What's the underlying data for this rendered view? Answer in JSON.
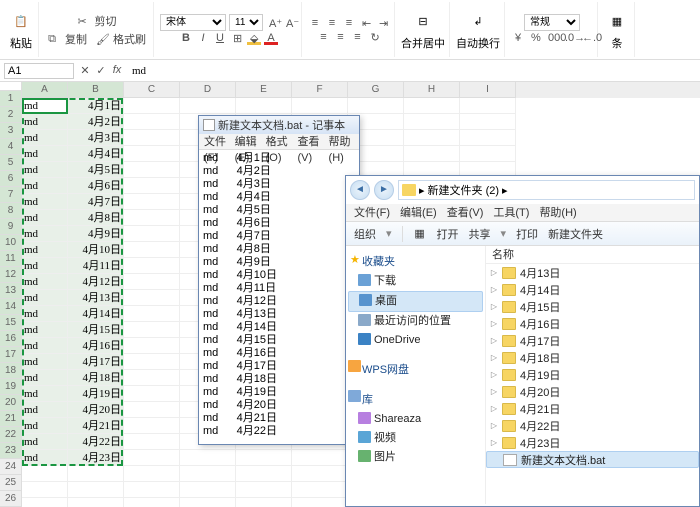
{
  "ribbon": {
    "paste": "粘贴",
    "cut": "剪切",
    "copy": "复制",
    "format_painter": "格式刷",
    "font_name": "宋体",
    "font_size": "11",
    "merge_center": "合并居中",
    "wrap": "自动换行",
    "number_format": "常规",
    "cond": "条"
  },
  "formula_bar": {
    "cell_ref": "A1",
    "formula": "md"
  },
  "columns": [
    "A",
    "B",
    "C",
    "D",
    "E",
    "F",
    "G",
    "H",
    "I"
  ],
  "spreadsheet": {
    "rows": [
      {
        "r": 1,
        "a": "md",
        "b": "4月1日"
      },
      {
        "r": 2,
        "a": "md",
        "b": "4月2日"
      },
      {
        "r": 3,
        "a": "md",
        "b": "4月3日"
      },
      {
        "r": 4,
        "a": "md",
        "b": "4月4日"
      },
      {
        "r": 5,
        "a": "md",
        "b": "4月5日"
      },
      {
        "r": 6,
        "a": "md",
        "b": "4月6日"
      },
      {
        "r": 7,
        "a": "md",
        "b": "4月7日"
      },
      {
        "r": 8,
        "a": "md",
        "b": "4月8日"
      },
      {
        "r": 9,
        "a": "md",
        "b": "4月9日"
      },
      {
        "r": 10,
        "a": "md",
        "b": "4月10日"
      },
      {
        "r": 11,
        "a": "md",
        "b": "4月11日"
      },
      {
        "r": 12,
        "a": "md",
        "b": "4月12日"
      },
      {
        "r": 13,
        "a": "md",
        "b": "4月13日"
      },
      {
        "r": 14,
        "a": "md",
        "b": "4月14日"
      },
      {
        "r": 15,
        "a": "md",
        "b": "4月15日"
      },
      {
        "r": 16,
        "a": "md",
        "b": "4月16日"
      },
      {
        "r": 17,
        "a": "md",
        "b": "4月17日"
      },
      {
        "r": 18,
        "a": "md",
        "b": "4月18日"
      },
      {
        "r": 19,
        "a": "md",
        "b": "4月19日"
      },
      {
        "r": 20,
        "a": "md",
        "b": "4月20日"
      },
      {
        "r": 21,
        "a": "md",
        "b": "4月21日"
      },
      {
        "r": 22,
        "a": "md",
        "b": "4月22日"
      },
      {
        "r": 23,
        "a": "md",
        "b": "4月23日"
      }
    ],
    "extra_empty_rows": [
      24,
      25,
      26
    ]
  },
  "notepad": {
    "title": "新建文本文档.bat - 记事本",
    "menus": [
      "文件(F)",
      "编辑(E)",
      "格式(O)",
      "查看(V)",
      "帮助(H)"
    ],
    "lines": [
      "md      4月1日",
      "md      4月2日",
      "md      4月3日",
      "md      4月4日",
      "md      4月5日",
      "md      4月6日",
      "md      4月7日",
      "md      4月8日",
      "md      4月9日",
      "md      4月10日",
      "md      4月11日",
      "md      4月12日",
      "md      4月13日",
      "md      4月14日",
      "md      4月15日",
      "md      4月16日",
      "md      4月17日",
      "md      4月18日",
      "md      4月19日",
      "md      4月20日",
      "md      4月21日",
      "md      4月22日"
    ]
  },
  "explorer": {
    "breadcrumb": "新建文件夹 (2)",
    "crumb_sep": "▸",
    "menus": [
      "文件(F)",
      "编辑(E)",
      "查看(V)",
      "工具(T)",
      "帮助(H)"
    ],
    "toolbar": {
      "organize": "组织",
      "open": "打开",
      "share": "共享",
      "print": "打印",
      "newfolder": "新建文件夹"
    },
    "nav": {
      "favorites": "收藏夹",
      "downloads": "下载",
      "desktop": "桌面",
      "recent": "最近访问的位置",
      "onedrive": "OneDrive",
      "wps": "WPS网盘",
      "library": "库",
      "shareaza": "Shareaza",
      "video": "视频",
      "pictures": "图片"
    },
    "list_header": "名称",
    "folders": [
      "4月13日",
      "4月14日",
      "4月15日",
      "4月16日",
      "4月17日",
      "4月18日",
      "4月19日",
      "4月20日",
      "4月21日",
      "4月22日",
      "4月23日"
    ],
    "selected_file": "新建文本文档.bat"
  }
}
